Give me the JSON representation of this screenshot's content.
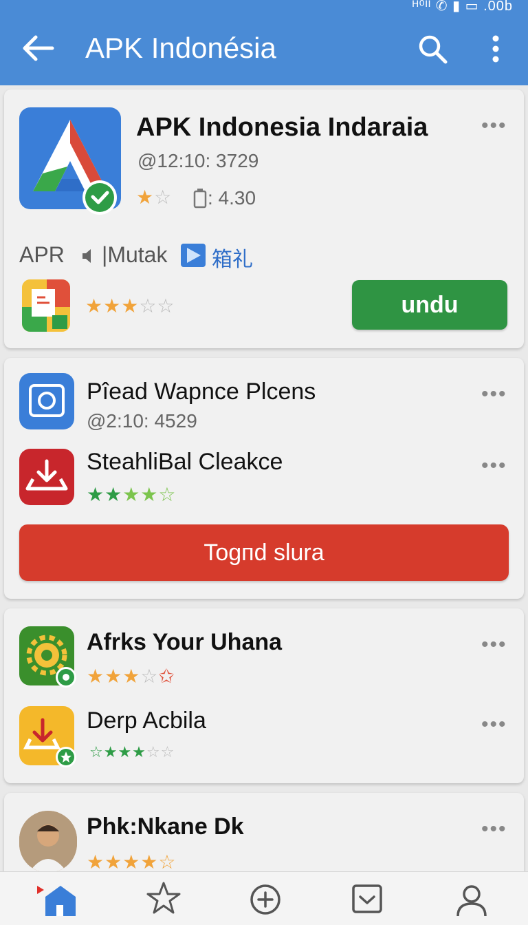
{
  "status": {
    "text": "ᴴ⁰ᴵᴵ  ✆  ▮  ▭  .00b"
  },
  "appbar": {
    "title": "APK Indonésia"
  },
  "card1": {
    "name": "APK Indonesia Indaraia",
    "meta": "@12:10: 3729",
    "rating_text": ": 4.30",
    "tag_apr": "APR",
    "tag_mutak": "|Mutak",
    "tag_cjk": "箱礼",
    "download_label": "undu"
  },
  "card2": {
    "item1_name": "Pîead Wapnce Plcens",
    "item1_meta": "@2:10: 4529",
    "item2_name": "SteahliBal Cleakce",
    "button_label": "Togпd slura"
  },
  "card3": {
    "item1_name": "Afrks Your Uhana",
    "item2_name": "Derp Acbila"
  },
  "card4": {
    "item1_name": "Phk:Nkane Dk"
  },
  "icons": [
    "arrow-left",
    "search",
    "more-vert",
    "more-horiz",
    "home",
    "star",
    "add-circle",
    "download-box",
    "person"
  ],
  "colors": {
    "appbar": "#4a8bd6",
    "download_button": "#2f9443",
    "action_button": "#d63b2c",
    "star": "#f1a33a",
    "star_green": "#2e9c46"
  }
}
